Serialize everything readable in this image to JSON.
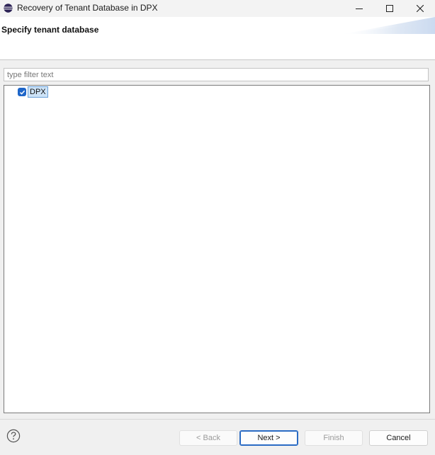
{
  "window": {
    "title": "Recovery of Tenant Database in DPX"
  },
  "header": {
    "title": "Specify tenant database"
  },
  "filter": {
    "placeholder": "type filter text",
    "value": ""
  },
  "tree": {
    "items": [
      {
        "label": "DPX",
        "checked": true,
        "selected": true
      }
    ]
  },
  "buttons": {
    "back": "< Back",
    "next": "Next >",
    "finish": "Finish",
    "cancel": "Cancel"
  },
  "icons": {
    "app": "eclipse-app-icon",
    "minimize": "minimize-icon",
    "maximize": "maximize-icon",
    "close": "close-icon",
    "help": "help-icon",
    "checkbox": "checkbox-checked-icon"
  },
  "colors": {
    "accent": "#1e66c9",
    "selection": "#cde3f7",
    "primary_border": "#2a6bc4"
  }
}
